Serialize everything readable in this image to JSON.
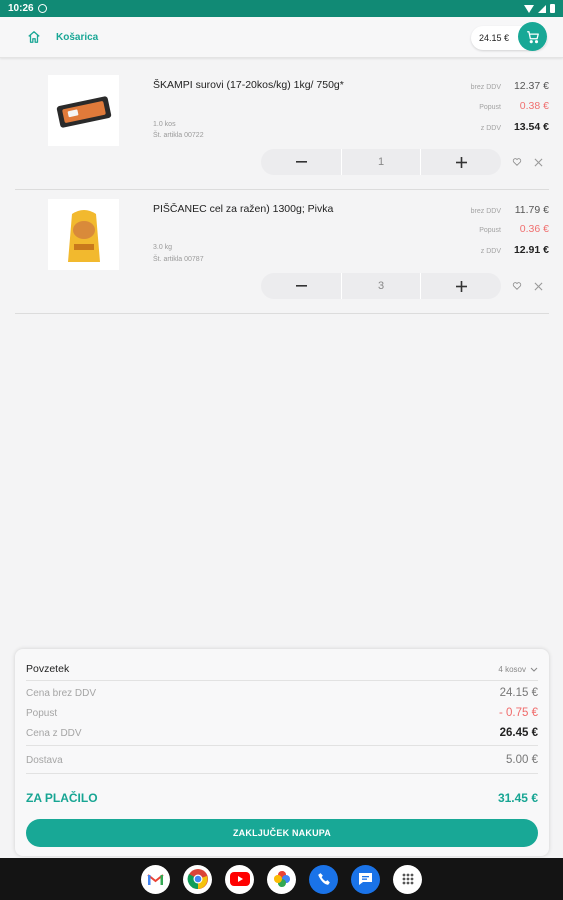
{
  "status_bar": {
    "time": "10:26"
  },
  "header": {
    "title": "Košarica",
    "cart_total": "24.15 €"
  },
  "items": [
    {
      "name": "ŠKAMPI surovi (17-20kos/kg) 1kg/ 750g*",
      "weight": "1.0 kos",
      "code": "Št. artikla 00722",
      "price_excl_label": "brez DDV",
      "price_excl": "12.37 €",
      "discount_label": "Popust",
      "discount": "0.38 €",
      "price_incl_label": "z DDV",
      "price_incl": "13.54 €",
      "quantity": "1"
    },
    {
      "name": "PIŠČANEC cel za ražen) 1300g; Pivka",
      "weight": "3.0 kg",
      "code": "Št. artikla 00787",
      "price_excl_label": "brez DDV",
      "price_excl": "11.79 €",
      "discount_label": "Popust",
      "discount": "0.36 €",
      "price_incl_label": "z DDV",
      "price_incl": "12.91 €",
      "quantity": "3"
    }
  ],
  "summary": {
    "title": "Povzetek",
    "count": "4 kosov",
    "rows": [
      {
        "label": "Cena brez DDV",
        "value": "24.15 €"
      },
      {
        "label": "Popust",
        "value": "- 0.75 €"
      },
      {
        "label": "Cena z DDV",
        "value": "26.45 €"
      },
      {
        "label": "Dostava",
        "value": "5.00 €"
      }
    ],
    "pay_label": "ZA PLAČILO",
    "pay_value": "31.45 €",
    "checkout_label": "ZAKLJUČEK NAKUPA"
  },
  "navbar": {
    "apps": [
      "gmail-icon",
      "chrome-icon",
      "youtube-icon",
      "photos-icon",
      "phone-icon",
      "messages-icon",
      "app-drawer-icon"
    ]
  },
  "colors": {
    "accent": "#18a896",
    "status_bar": "#118a75",
    "discount": "#f07070"
  }
}
